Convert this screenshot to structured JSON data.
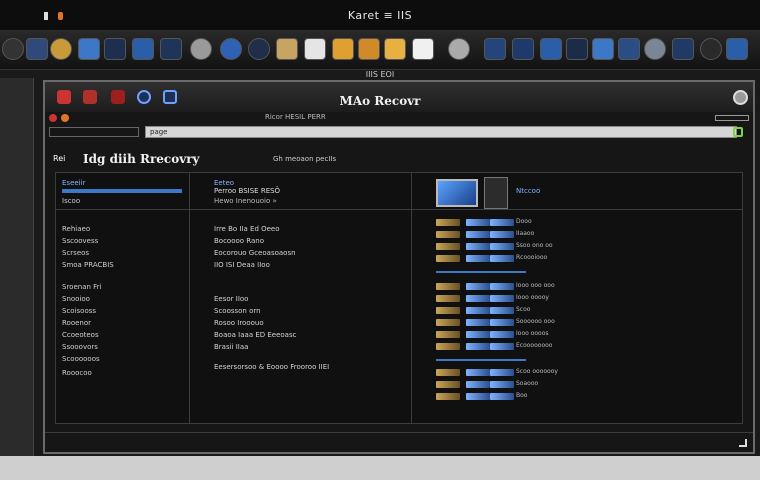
{
  "menubar": {
    "title": "Karet ≡ IIS"
  },
  "dock": {
    "label": "IIIS EOI"
  },
  "window": {
    "title": "MAo Recovr",
    "toolbar_text": "Ricor HESIL PERR",
    "address": "page"
  },
  "section": {
    "tag": "Rei",
    "title": "Idg diih Rrecovry",
    "subtitle": "Gh meoaon pecIIs"
  },
  "left_pane": {
    "header": "Eseeiir",
    "subheader": "Iscoo",
    "items": [
      "Rehiaeo",
      "Sscoovess",
      "Scrseos",
      "Smoa PRACBIS",
      "Sroenan Fri",
      "Snooioo",
      "Scoisooss",
      "Rooenor",
      "Ccoeoteos",
      "Ssooovors",
      "Scoooooos",
      "Rooocoo"
    ]
  },
  "mid_pane": {
    "header1": "Eeteo",
    "header2": "Perroo BSISE RESÔ",
    "header3": "Hewo  Inenouoio »",
    "items": [
      "Irre Bo IIa Ed Oeeo",
      "Bocoooo Rano",
      "Eocorouo Gceoasoaosn",
      "IIO  ISI  Deaa  IIoo",
      "Eesor IIoo",
      "Scoosson orn",
      "Rosoo Irooouo",
      "Boaoa Iaaa ED Eeeoasc",
      "Brasii IIaa",
      "Eesersorsoo  &  Eoooo Frooroo IIEI"
    ]
  },
  "right_pane": {
    "device_label": "Ntccoo",
    "rows": [
      "Dooo",
      "IIaaoo",
      "Ssoo ono oo",
      "Rcoooiooo",
      "Iooo ooo ooo",
      "Iooo ooooy",
      "Scoo",
      "Soooooo ooo",
      "Iooo oooos",
      "Ecoooooooo",
      "Scoo ooooooy",
      "Soaooo",
      "Boo"
    ]
  },
  "colors": {
    "accent": "#3d78c8",
    "link": "#88b6ff",
    "ok": "#7fd34a",
    "close_red": "#cc3333",
    "minimize_orange": "#e0762a"
  }
}
